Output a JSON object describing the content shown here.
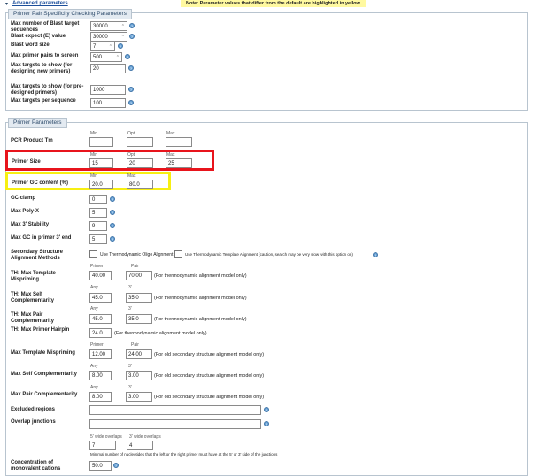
{
  "header": {
    "advanced_link": "Advanced parameters",
    "note": "Note: Parameter values that differ from the default are highlighted in yellow"
  },
  "specificity": {
    "legend": "Primer Pair Specificity Checking Parameters",
    "max_targets_label": "Max number of Blast target sequences",
    "max_targets_value": "30000",
    "expect_label": "Blast expect (E) value",
    "expect_value": "30000",
    "word_size_label": "Blast word size",
    "word_size_value": "7",
    "max_pairs_label": "Max primer pairs to screen",
    "max_pairs_value": "500",
    "max_targets_design_label": "Max targets to show (for designing new primers)",
    "max_targets_design_value": "20",
    "max_targets_pre_label": "Max targets to show (for pre-designed primers)",
    "max_targets_pre_value": "1000",
    "max_targets_seq_label": "Max targets per sequence",
    "max_targets_seq_value": "100"
  },
  "primer": {
    "legend": "Primer Parameters",
    "col_min": "Min",
    "col_opt": "Opt",
    "col_max": "Max",
    "pcr_tm_label": "PCR Product Tm",
    "pcr_tm_min": "",
    "pcr_tm_opt": "",
    "pcr_tm_max": "",
    "size_label": "Primer Size",
    "size_min": "15",
    "size_opt": "20",
    "size_max": "25",
    "gc_label": "Primer GC content (%)",
    "gc_min": "20.0",
    "gc_max": "80.0",
    "gc_clamp_label": "GC clamp",
    "gc_clamp_value": "0",
    "poly_x_label": "Max Poly-X",
    "poly_x_value": "5",
    "stability_label": "Max 3' Stability",
    "stability_value": "9",
    "gc_end_label": "Max GC in primer 3' end",
    "gc_end_value": "5",
    "secondary_label": "Secondary Structure Alignment Methods",
    "oligo_align": "Use Thermodynamic Oligo Alignment",
    "template_align": "Use Thermodynamic Template Alignment (caution, search may be very slow with this option on)",
    "col_primer": "Primer",
    "col_pair": "Pair",
    "col_any": "Any",
    "col_3": "3'",
    "th_mispriming_label": "TH: Max Template Mispriming",
    "th_mispriming_primer": "40.00",
    "th_mispriming_pair": "70.00",
    "th_note": "(For thermodynamic alignment model only)",
    "th_self_label": "TH: Max Self Complementarity",
    "th_self_any": "45.0",
    "th_self_3": "35.0",
    "th_pair_label": "TH: Max Pair Complementarity",
    "th_pair_any": "45.0",
    "th_pair_3": "35.0",
    "th_hairpin_label": "TH: Max Primer Hairpin",
    "th_hairpin_value": "24.0",
    "th_hairpin_note": "(For thermodynamic alignment model only)",
    "mispriming_label": "Max Template Mispriming",
    "mispriming_primer": "12.00",
    "mispriming_pair": "24.00",
    "old_note": "(For old secondary structure alignment model only)",
    "self_label": "Max Self Complementarity",
    "self_any": "8.00",
    "self_3": "3.00",
    "pair_label": "Max Pair Complementarity",
    "pair_any": "8.00",
    "pair_3": "3.00",
    "excluded_label": "Excluded regions",
    "excluded_value": "",
    "overlap_label": "Overlap junctions",
    "overlap_value": "",
    "col_5overlap": "5' wide overlaps",
    "col_3overlap": "3' wide overlaps",
    "overlap_5_value": "7",
    "overlap_3_value": "4",
    "overlap_note": "Minimal number of nucleotides that the left or the right primer must have at the 5' or 3' side of the junctions",
    "conc_label": "Concentration of monovalent cations",
    "conc_value": "50.0"
  },
  "highlight_colors": {
    "red_box": "#e8141c",
    "yellow_box": "#f7ef12",
    "note_bg": "#fff9a0"
  }
}
